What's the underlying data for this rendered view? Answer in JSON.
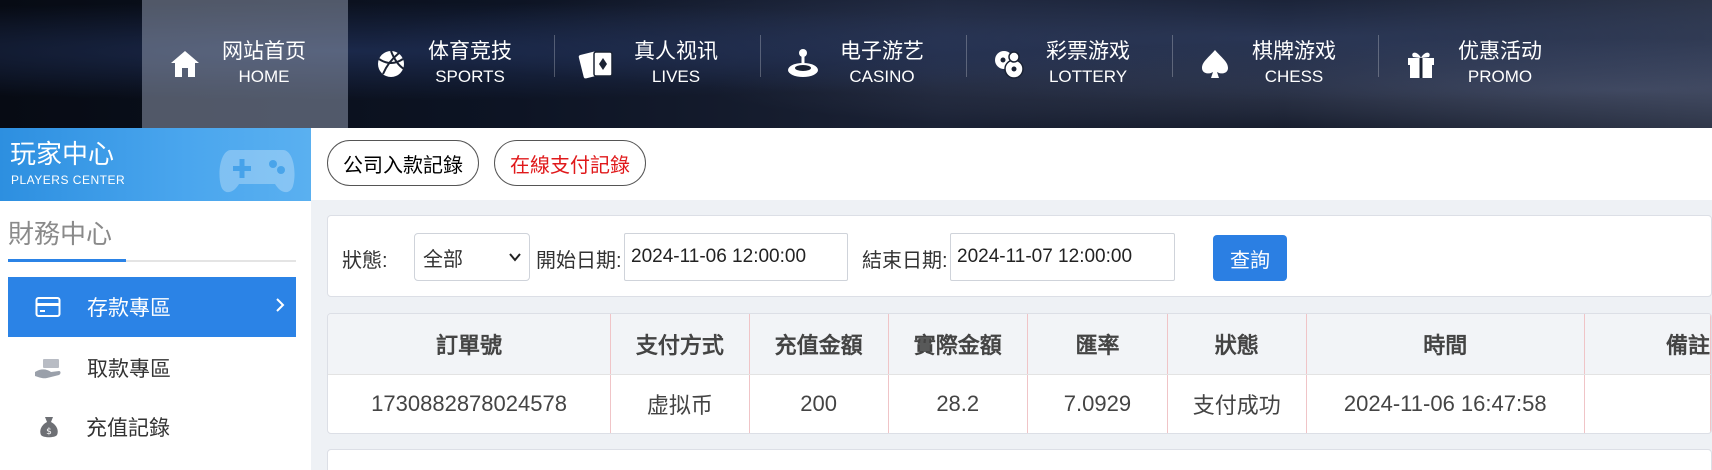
{
  "nav": {
    "items": [
      {
        "cn": "网站首页",
        "en": "HOME",
        "icon": "home-icon",
        "active": true
      },
      {
        "cn": "体育竞技",
        "en": "SPORTS",
        "icon": "basketball-icon"
      },
      {
        "cn": "真人视讯",
        "en": "LIVES",
        "icon": "cards-icon"
      },
      {
        "cn": "电子游艺",
        "en": "CASINO",
        "icon": "joystick-icon"
      },
      {
        "cn": "彩票游戏",
        "en": "LOTTERY",
        "icon": "lottery-balls-icon"
      },
      {
        "cn": "棋牌游戏",
        "en": "CHESS",
        "icon": "spade-icon"
      },
      {
        "cn": "优惠活动",
        "en": "PROMO",
        "icon": "gift-icon"
      }
    ]
  },
  "sidebar": {
    "banner_cn": "玩家中心",
    "banner_en": "PLAYERS CENTER",
    "section_title": "財務中心",
    "items": [
      {
        "label": "存款專區",
        "icon": "card-icon",
        "active": true
      },
      {
        "label": "取款專區",
        "icon": "withdraw-hand-icon"
      },
      {
        "label": "充值記錄",
        "icon": "money-bag-icon"
      }
    ]
  },
  "tabs": {
    "company_deposit": "公司入款記錄",
    "online_payment": "在線支付記錄"
  },
  "filter": {
    "status_label": "狀態:",
    "status_value": "全部",
    "start_label": "開始日期:",
    "start_value": "2024-11-06 12:00:00",
    "end_label": "結束日期:",
    "end_value": "2024-11-07 12:00:00",
    "query_label": "查詢"
  },
  "table": {
    "headers": [
      "訂單號",
      "支付方式",
      "充值金額",
      "實際金額",
      "匯率",
      "狀態",
      "時間",
      "備註"
    ],
    "rows": [
      [
        "1730882878024578",
        "虚拟币",
        "200",
        "28.2",
        "7.0929",
        "支付成功",
        "2024-11-06 16:47:58",
        ""
      ]
    ]
  },
  "colors": {
    "accent": "#2b83e6",
    "tab_red": "#e0191b"
  }
}
